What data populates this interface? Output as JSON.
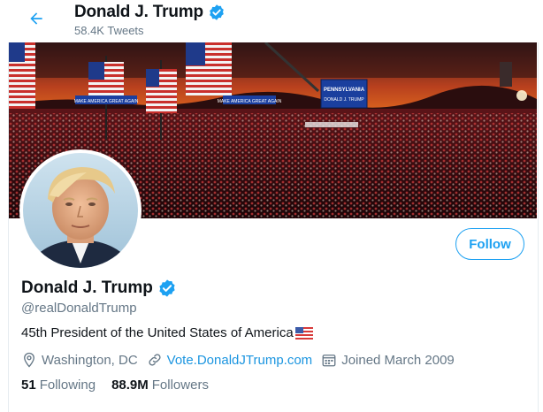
{
  "header": {
    "name": "Donald J. Trump",
    "tweet_count": "58.4K Tweets"
  },
  "banner": {
    "sign_left": "MAKE AMERICA GREAT AGAIN",
    "sign_mid": "MAKE AMERICA GREAT AGAIN",
    "screen_line1": "PENNSYLVANIA",
    "screen_line2": "DONALD J. TRUMP"
  },
  "profile": {
    "name": "Donald J. Trump",
    "handle": "@realDonaldTrump",
    "bio": "45th President of the United States of America",
    "bio_flag": "US flag emoji",
    "follow_label": "Follow",
    "location": "Washington, DC",
    "website": "Vote.DonaldJTrump.com",
    "joined": "Joined March 2009",
    "following_count": "51",
    "following_label": "Following",
    "followers_count": "88.9M",
    "followers_label": "Followers"
  },
  "colors": {
    "accent": "#1da1f2",
    "link": "#1b95e0",
    "muted": "#657786",
    "verified": "#1da1f2"
  },
  "icons": [
    "back-arrow-icon",
    "verified-badge-icon",
    "location-pin-icon",
    "link-icon",
    "calendar-icon"
  ]
}
